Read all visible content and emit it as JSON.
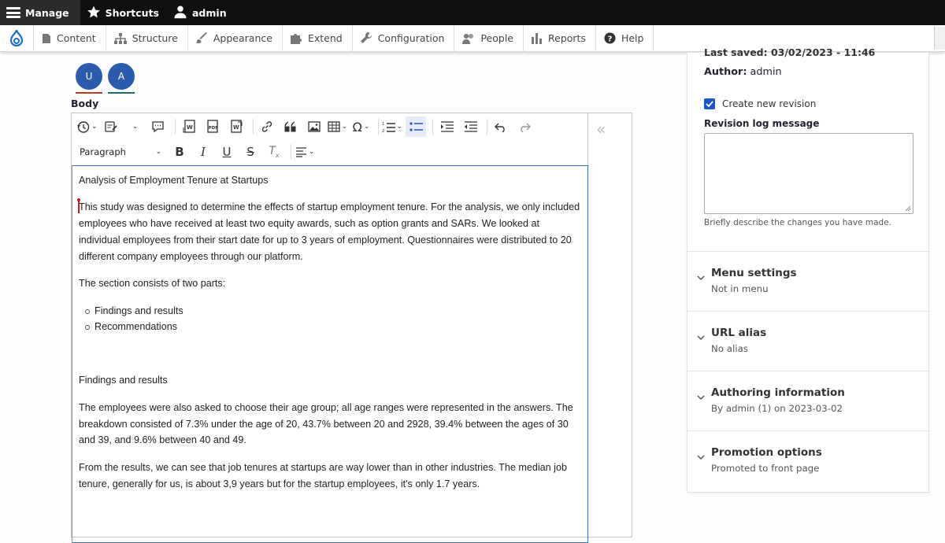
{
  "topbar": {
    "manage_label": "Manage",
    "shortcuts_label": "Shortcuts",
    "user_label": "admin"
  },
  "admin_menu": {
    "items": [
      {
        "label": "Content",
        "icon": "page-icon"
      },
      {
        "label": "Structure",
        "icon": "structure-icon"
      },
      {
        "label": "Appearance",
        "icon": "brush-icon"
      },
      {
        "label": "Extend",
        "icon": "puzzle-icon"
      },
      {
        "label": "Configuration",
        "icon": "wrench-icon"
      },
      {
        "label": "People",
        "icon": "people-icon"
      },
      {
        "label": "Reports",
        "icon": "bar-chart-icon"
      },
      {
        "label": "Help",
        "icon": "help-icon"
      }
    ]
  },
  "collaborators": [
    {
      "initial": "U",
      "color": "#2b5bad",
      "underline": "#c0392b"
    },
    {
      "initial": "A",
      "color": "#2b5bad",
      "underline": "#1f6b6b"
    }
  ],
  "body_label": "Body",
  "editor": {
    "heading_select": "Paragraph",
    "content": {
      "title": "Analysis of Employment Tenure at Startups",
      "intro": "This study was designed to determine the effects of startup employment tenure. For the analysis, we only included employees who have received at least two equity awards, such as option grants and SARs. We looked at individual employees from their start date for up to 3 years of employment. Questionnaires were distributed to 20 different company employees through our platform.",
      "section_intro": "The section consists of two parts:",
      "list": [
        "Findings and results",
        "Recommendations"
      ],
      "findings_heading": "Findings and results",
      "findings_p1": "The employees were also asked to choose their age group; all age ranges were represented in the answers. The breakdown consisted of 7.3% under the age of 20, 43.7% between 20 and 2928, 39.4% between the ages of 30 and 39, and 9.6% between 40 and 49.",
      "findings_p2": "From the results, we can see that job tenures at startups are way lower than in other industries. The median job tenure, generally for us, is about 3,9 years but for the startup employees, it's only 1.7 years."
    }
  },
  "sidebar": {
    "clipped_label": "Last saved: 03/02/2023 - 11:46",
    "author_label": "Author:",
    "author_value": "admin",
    "create_revision_label": "Create new revision",
    "create_revision_checked": true,
    "revision_log_label": "Revision log message",
    "revision_log_help": "Briefly describe the changes you have made.",
    "sections": [
      {
        "title": "Menu settings",
        "subtitle": "Not in menu"
      },
      {
        "title": "URL alias",
        "subtitle": "No alias"
      },
      {
        "title": "Authoring information",
        "subtitle": "By admin (1) on 2023-03-02"
      },
      {
        "title": "Promotion options",
        "subtitle": "Promoted to front page"
      }
    ]
  },
  "colors": {
    "accent": "#1f55c7",
    "topbar_bg": "#0f0f0f",
    "avatar": "#2b5bad"
  }
}
